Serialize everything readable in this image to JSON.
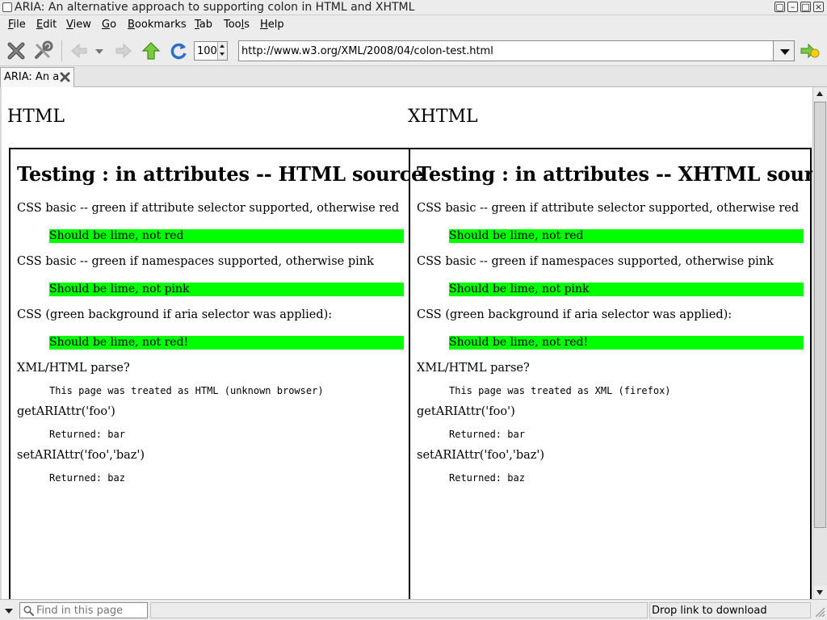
{
  "window": {
    "title": "ARIA: An alternative approach to supporting colon in HTML and XHTML"
  },
  "menubar": {
    "items": [
      {
        "label": "File",
        "mnemonic": "F",
        "rest": "ile"
      },
      {
        "label": "Edit",
        "mnemonic": "E",
        "rest": "dit"
      },
      {
        "label": "View",
        "mnemonic": "V",
        "rest": "iew"
      },
      {
        "label": "Go",
        "mnemonic": "G",
        "rest": "o"
      },
      {
        "label": "Bookmarks",
        "mnemonic": "B",
        "rest": "ookmarks"
      },
      {
        "label": "Tab",
        "mnemonic": "T",
        "rest": "ab"
      },
      {
        "label": "Tools",
        "pre": "Too",
        "mnemonic": "l",
        "rest": "s"
      },
      {
        "label": "Help",
        "mnemonic": "H",
        "rest": "elp"
      }
    ]
  },
  "toolbar": {
    "zoom_value": "100",
    "url": "http://www.w3.org/XML/2008/04/colon-test.html",
    "icons": [
      "stop-icon",
      "preferences-icon",
      "back-icon",
      "back-history-icon",
      "forward-icon",
      "up-icon",
      "reload-icon",
      "go-icon"
    ]
  },
  "tab": {
    "label": "ARIA: An a"
  },
  "page": {
    "columns": [
      "HTML",
      "XHTML"
    ],
    "frames": [
      {
        "title": "Testing : in attributes -- HTML source",
        "css_attr_label": "CSS basic -- green if attribute selector supported, otherwise red",
        "css_attr_result": "Should be lime, not red",
        "css_ns_label": "CSS basic -- green if namespaces supported, otherwise pink",
        "css_ns_result": "Should be lime, not pink",
        "css_aria_label": "CSS (green background if aria selector was applied):",
        "css_aria_result": "Should be lime, not red!",
        "parse_label": "XML/HTML parse?",
        "parse_result": "This page was treated as HTML (unknown browser)",
        "get_label": "getARIAttr('foo')",
        "get_result": "Returned: bar",
        "set_label": "setARIAttr('foo','baz')",
        "set_result": "Returned: baz"
      },
      {
        "title": "Testing : in attributes -- XHTML source",
        "css_attr_label": "CSS basic -- green if attribute selector supported, otherwise red",
        "css_attr_result": "Should be lime, not red",
        "css_ns_label": "CSS basic -- green if namespaces supported, otherwise pink",
        "css_ns_result": "Should be lime, not pink",
        "css_aria_label": "CSS (green background if aria selector was applied):",
        "css_aria_result": "Should be lime, not red!",
        "parse_label": "XML/HTML parse?",
        "parse_result": "This page was treated as XML (firefox)",
        "get_label": "getARIAttr('foo')",
        "get_result": "Returned: bar",
        "set_label": "setARIAttr('foo','baz')",
        "set_result": "Returned: baz"
      }
    ]
  },
  "statusbar": {
    "find_placeholder": "Find in this page",
    "status_text": "Drop link to download"
  },
  "colors": {
    "pass": "#00ff00",
    "chrome": "#ececec"
  }
}
